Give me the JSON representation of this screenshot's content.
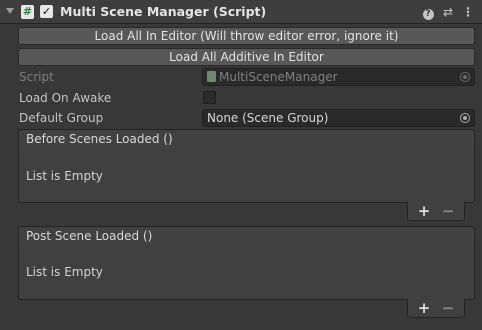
{
  "header": {
    "script_icon_glyph": "#",
    "enabled_glyph": "✓",
    "title": "Multi Scene Manager (Script)",
    "icons": [
      "foldout-arrow-icon",
      "script-icon",
      "help-icon",
      "presets-icon",
      "more-options-icon"
    ]
  },
  "buttons": {
    "load_all": "Load All In Editor (Will throw editor error, ignore it)",
    "load_all_additive": "Load All Additive In Editor"
  },
  "properties": {
    "script": {
      "label": "Script",
      "value": "MultiSceneManager"
    },
    "load_on_awake": {
      "label": "Load On Awake",
      "checked": false
    },
    "default_group": {
      "label": "Default Group",
      "value": "None (Scene Group)"
    }
  },
  "events": [
    {
      "header": "Before Scenes Loaded ()",
      "empty_text": "List is Empty",
      "add_label": "+",
      "remove_label": "−"
    },
    {
      "header": "Post Scene Loaded ()",
      "empty_text": "List is Empty",
      "add_label": "+",
      "remove_label": "−"
    }
  ],
  "colors": {
    "background": "#383838",
    "header": "#3e3e3e",
    "button": "#585858",
    "field": "#2a2a2a",
    "text": "#d2d2d2"
  }
}
